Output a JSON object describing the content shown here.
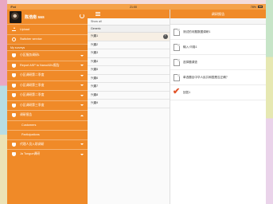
{
  "status_bar": {
    "carrier": "iPad",
    "time": "21:00",
    "battery": "78%"
  },
  "profile": {
    "name": "陈浩南 sas"
  },
  "nav": {
    "top_items": [
      {
        "label": "Upload",
        "icon": "upload-icon"
      },
      {
        "label": "Switcher service",
        "icon": "gear-icon"
      }
    ],
    "section_label": "My surveys",
    "survey_items": [
      {
        "label": "小区服务调研1"
      },
      {
        "label": "Report ASP to NanoADU报告"
      },
      {
        "label": "小区调研第二季度"
      },
      {
        "label": "小区调研第三季度"
      },
      {
        "label": "小区调研第二季度"
      },
      {
        "label": "小区调研第三季度"
      },
      {
        "label": "调研报告",
        "expanded": true
      }
    ],
    "sub_items": [
      {
        "label": "Customers"
      },
      {
        "label": "Participations"
      }
    ],
    "bottom_items": [
      {
        "label": "代理人员入职调研"
      },
      {
        "label": "Ja Tongue调研"
      }
    ]
  },
  "middle": {
    "subheader": "Show all",
    "group": "Generic",
    "items": [
      "兴趣1",
      "兴趣2",
      "兴趣3",
      "兴趣4",
      "兴趣5",
      "兴趣6",
      "兴趣7",
      "兴趣8",
      "兴趣9"
    ]
  },
  "right": {
    "title": "调研报告",
    "items": [
      {
        "label": "测试的问题数据调研1",
        "icon": "document-icon"
      },
      {
        "label": "输入·问卷1",
        "icon": "document-icon"
      },
      {
        "label": "选择题调查",
        "icon": "document-icon"
      },
      {
        "label": "单选题目中华人民共和国是否正确？",
        "icon": "document-icon"
      },
      {
        "label": "回答1",
        "icon": "checkmark-icon",
        "checked": true
      }
    ]
  },
  "colors": {
    "accent": "#f08a28",
    "check": "#e2542a"
  }
}
